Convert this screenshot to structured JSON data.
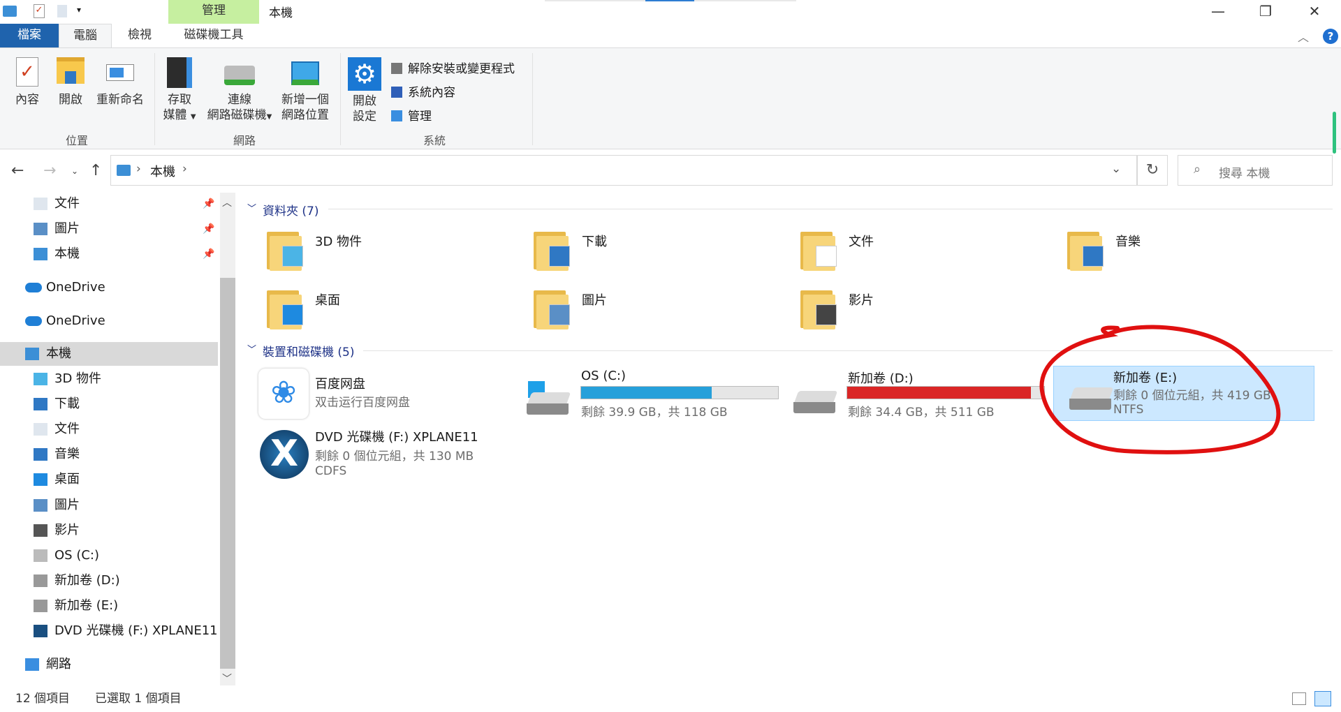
{
  "window": {
    "title": "本機",
    "context_tab_header": "管理",
    "context_tab": "磁碟機工具"
  },
  "tabs": [
    {
      "label": "檔案"
    },
    {
      "label": "電腦"
    },
    {
      "label": "檢視"
    },
    {
      "label": "磁碟機工具"
    }
  ],
  "ribbon": {
    "location": {
      "label": "位置",
      "buttons": [
        "內容",
        "開啟",
        "重新命名"
      ]
    },
    "network": {
      "label": "網路",
      "access_media": [
        "存取",
        "媒體"
      ],
      "map_drive": [
        "連線",
        "網路磁碟機"
      ],
      "add_location": [
        "新增一個",
        "網路位置"
      ]
    },
    "system": {
      "label": "系統",
      "open_settings": [
        "開啟",
        "設定"
      ],
      "items": [
        "解除安裝或變更程式",
        "系統內容",
        "管理"
      ]
    }
  },
  "address": {
    "crumb": "本機",
    "search_placeholder": "搜尋 本機"
  },
  "sidebar": {
    "items": [
      {
        "label": "文件",
        "icon": "document-icon",
        "pinned": true
      },
      {
        "label": "圖片",
        "icon": "pictures-icon",
        "pinned": true
      },
      {
        "label": "本機",
        "icon": "computer-icon",
        "pinned": true
      },
      {
        "label": "OneDrive",
        "icon": "onedrive-icon"
      },
      {
        "label": "OneDrive",
        "icon": "onedrive-icon"
      },
      {
        "label": "本機",
        "icon": "computer-icon",
        "selected": true
      },
      {
        "label": "3D 物件",
        "icon": "3d-objects-icon"
      },
      {
        "label": "下載",
        "icon": "download-icon"
      },
      {
        "label": "文件",
        "icon": "document-icon"
      },
      {
        "label": "音樂",
        "icon": "music-icon"
      },
      {
        "label": "桌面",
        "icon": "desktop-icon"
      },
      {
        "label": "圖片",
        "icon": "pictures-icon"
      },
      {
        "label": "影片",
        "icon": "video-icon"
      },
      {
        "label": "OS (C:)",
        "icon": "windows-drive-icon"
      },
      {
        "label": "新加卷 (D:)",
        "icon": "drive-icon"
      },
      {
        "label": "新加卷 (E:)",
        "icon": "drive-icon"
      },
      {
        "label": "DVD 光碟機 (F:) XPLANE11",
        "icon": "xplane-icon"
      },
      {
        "label": "網路",
        "icon": "network-icon"
      }
    ]
  },
  "folders": {
    "header": "資料夾 (7)",
    "items": [
      "3D 物件",
      "下載",
      "文件",
      "音樂",
      "桌面",
      "圖片",
      "影片"
    ]
  },
  "devices": {
    "header": "裝置和磁碟機 (5)",
    "items": [
      {
        "name": "百度网盘",
        "sub": "双击运行百度网盘"
      },
      {
        "name": "OS (C:)",
        "sub": "剩餘 39.9 GB，共 118 GB",
        "used_fraction": 0.662,
        "bar_color": "#26a0da"
      },
      {
        "name": "新加卷 (D:)",
        "sub": "剩餘 34.4 GB，共 511 GB",
        "used_fraction": 0.933,
        "bar_color": "#da2626"
      },
      {
        "name": "新加卷 (E:)",
        "sub": "剩餘 0 個位元組，共 419 GB",
        "fs": "NTFS",
        "selected": true
      },
      {
        "name": "DVD 光碟機 (F:) XPLANE11",
        "sub": "剩餘 0 個位元組，共 130 MB",
        "fs": "CDFS"
      }
    ]
  },
  "status": {
    "count": "12 個項目",
    "selected": "已選取 1 個項目"
  },
  "colors": {
    "accent": "#005a9e",
    "selection": "#cce8ff",
    "annotation": "#e01010"
  }
}
